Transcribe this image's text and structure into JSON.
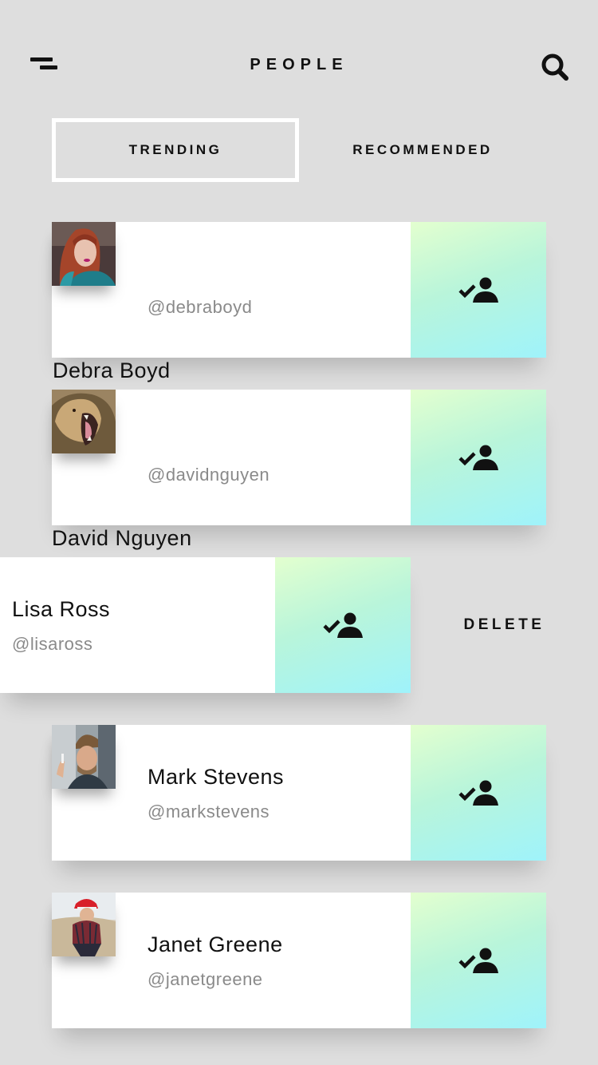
{
  "header": {
    "title": "PEOPLE",
    "menu_icon": "menu-icon",
    "search_icon": "search-icon"
  },
  "tabs": [
    {
      "label": "TRENDING",
      "active": true
    },
    {
      "label": "RECOMMENDED",
      "active": false
    }
  ],
  "people": [
    {
      "name": "Debra Boyd",
      "handle": "@debraboyd",
      "avatar": "woman-red-hair-photo",
      "action_icon": "add-friend-icon"
    },
    {
      "name": "David Nguyen",
      "handle": "@davidnguyen",
      "avatar": "lion-roaring-photo",
      "action_icon": "add-friend-icon"
    },
    {
      "name": "Lisa Ross",
      "handle": "@lisaross",
      "avatar": "",
      "action_icon": "add-friend-icon",
      "swipe_action": "DELETE"
    },
    {
      "name": "Mark Stevens",
      "handle": "@markstevens",
      "avatar": "man-beanie-photo",
      "action_icon": "add-friend-icon"
    },
    {
      "name": "Janet Greene",
      "handle": "@janetgreene",
      "avatar": "woman-red-cap-photo",
      "action_icon": "add-friend-icon"
    }
  ],
  "colors": {
    "background": "#dedede",
    "card": "#ffffff",
    "action_gradient_start": "#e3ffcf",
    "action_gradient_end": "#9ff3fb",
    "handle_text": "#8a8a8a"
  }
}
